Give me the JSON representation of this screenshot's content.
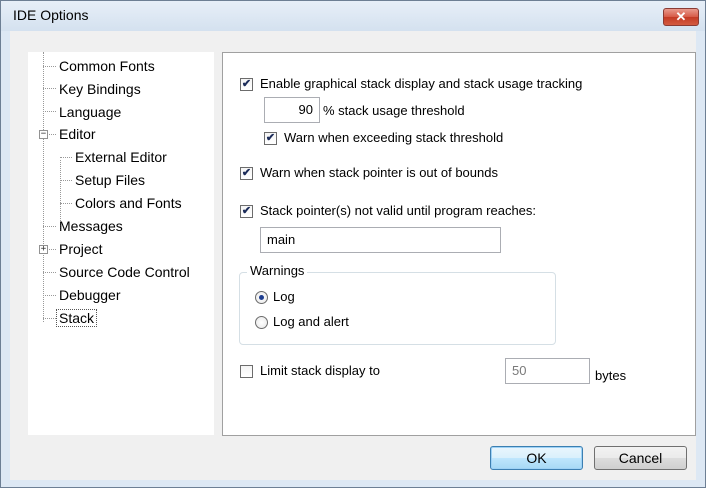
{
  "window": {
    "title": "IDE Options",
    "close_glyph": "✕"
  },
  "tree": {
    "items": [
      {
        "label": "Common Fonts"
      },
      {
        "label": "Key Bindings"
      },
      {
        "label": "Language"
      },
      {
        "label": "Editor",
        "expander": "−"
      },
      {
        "label": "External Editor"
      },
      {
        "label": "Setup Files"
      },
      {
        "label": "Colors and Fonts"
      },
      {
        "label": "Messages"
      },
      {
        "label": "Project",
        "expander": "+"
      },
      {
        "label": "Source Code Control"
      },
      {
        "label": "Debugger"
      },
      {
        "label": "Stack",
        "selected": true
      }
    ]
  },
  "stack": {
    "enable_label": "Enable graphical stack display and stack usage tracking",
    "enable_checked": true,
    "threshold_value": "90",
    "threshold_label": "% stack usage threshold",
    "warn_threshold_label": "Warn when exceeding stack threshold",
    "warn_threshold_checked": true,
    "warn_bounds_label": "Warn when stack pointer is out of bounds",
    "warn_bounds_checked": true,
    "sp_valid_label": "Stack pointer(s) not valid until program reaches:",
    "sp_valid_checked": true,
    "sp_valid_value": "main",
    "warnings_title": "Warnings",
    "log_label": "Log",
    "log_selected": true,
    "log_alert_label": "Log and alert",
    "limit_label": "Limit stack display to",
    "limit_checked": false,
    "limit_value": "50",
    "limit_unit": "bytes"
  },
  "buttons": {
    "ok": "OK",
    "cancel": "Cancel"
  },
  "check_glyph": "✔"
}
